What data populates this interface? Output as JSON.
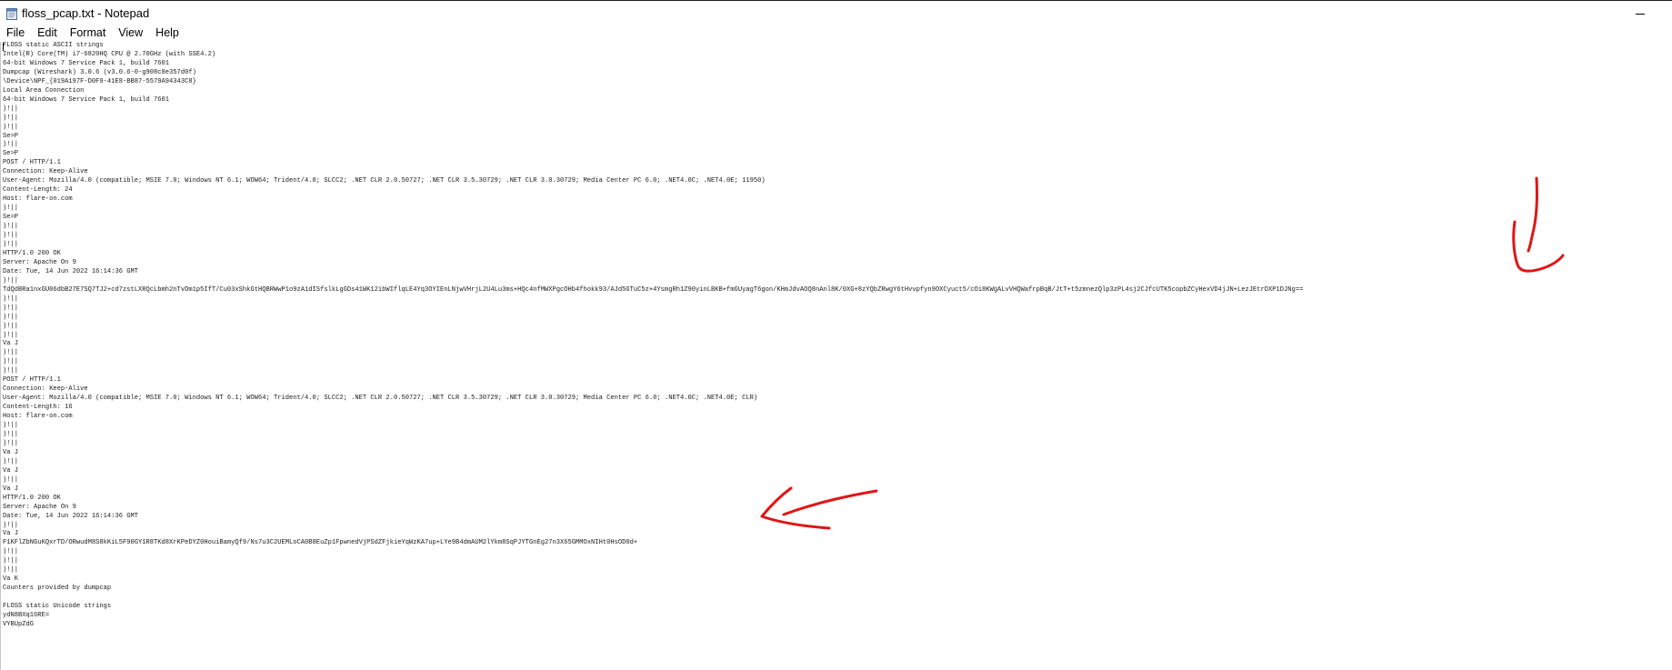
{
  "window": {
    "title": "floss_pcap.txt - Notepad"
  },
  "icons": {
    "app": "notepad-icon",
    "minimize": "minimize-icon"
  },
  "menu": {
    "items": [
      "File",
      "Edit",
      "Format",
      "View",
      "Help"
    ]
  },
  "editor": {
    "lines": [
      "FLOSS static ASCII strings",
      "Intel(R) Core(TM) i7-6820HQ CPU @ 2.70GHz (with SSE4.2)",
      "64-bit Windows 7 Service Pack 1, build 7601",
      "Dumpcap (Wireshark) 3.0.6 (v3.0.6-0-g908c8e357d0f)",
      "\\Device\\NPF_{019A197F-D0F9-41E8-BB87-5579A94343C8}",
      "Local Area Connection",
      "64-bit Windows 7 Service Pack 1, build 7601",
      ")!||",
      ")!||",
      ")!||",
      "Se>P",
      ")!||",
      "Se>P",
      "POST / HTTP/1.1",
      "Connection: Keep-Alive",
      "User-Agent: Mozilla/4.0 (compatible; MSIE 7.0; Windows NT 6.1; WOW64; Trident/4.0; SLCC2; .NET CLR 2.0.50727; .NET CLR 3.5.30729; .NET CLR 3.0.30729; Media Center PC 6.0; .NET4.0C; .NET4.0E; 11950)",
      "Content-Length: 24",
      "Host: flare-on.com",
      ")!||",
      "Se>P",
      ")!||",
      ")!||",
      ")!||",
      "HTTP/1.0 200 OK",
      "Server: Apache On 9",
      "Date: Tue, 14 Jun 2022 16:14:36 GMT",
      ")!||",
      "TdQdBRa1nxGU06dbB27E7SQ7TJ2+cd7zstLXRQcLbmh2nTvDm1p5IfT/Cu03xShkGtHQBRWwP1o9zA1dISfslkLgGDs41WK12ibWIflqLE4Yq3OYIEnLNjwVHrjL2U4Lu3ms+HQc4nfMWXPgcOHb4fhokk93/AJd5GTuC5z+4YsmgRh1Z90yinLBKB+fmGUyagT6gon/KHmJdvAOQ8nAnl8K/0XG+8zYQbZRwgY6tHvvpfyn9OXCyuct5/cOi8KWgALvVHQWafrpBqB/JtT+t5zmnezQlp3zPL4sj2CJfcUTK5copbZCyHexVD4jJN+LezJEtrDXP1DJNg==",
      ")!||",
      ")!||",
      ")!||",
      ")!||",
      ")!||",
      "Va J",
      ")!||",
      ")!||",
      ")!||",
      "POST / HTTP/1.1",
      "Connection: Keep-Alive",
      "User-Agent: Mozilla/4.0 (compatible; MSIE 7.0; Windows NT 6.1; WOW64; Trident/4.0; SLCC2; .NET CLR 2.0.50727; .NET CLR 3.5.30729; .NET CLR 3.0.30729; Media Center PC 6.0; .NET4.0C; .NET4.0E; CLR)",
      "Content-Length: 16",
      "Host: flare-on.com",
      ")!||",
      ")!||",
      ")!||",
      "Va J",
      ")!||",
      "Va J",
      ")!||",
      "Va J",
      "HTTP/1.0 200 OK",
      "Server: Apache On 9",
      "Date: Tue, 14 Jun 2022 16:14:36 GMT",
      ")!||",
      "Va J",
      "F1KFlZbNGuKQxrTD/ORwudM8S8kKiL5F90GY1R8TKd8XrKPeDYZ0HouiBamyQf9/Ns7u3C2UEMLoCA0B8EuZp1FpwnedVjPSdZFjkieYqWzKA7up+LYe9B4dmAUM2lYkm8SqPJYTGnEg27n3X65GMMOxNIHt0HsOD0d+",
      ")!||",
      ")!||",
      ")!||",
      "Va K",
      "Counters provided by dumpcap",
      "",
      "FLOSS static Unicode strings",
      "ydN8BXq16RE=",
      "VYBUpZdG"
    ]
  }
}
